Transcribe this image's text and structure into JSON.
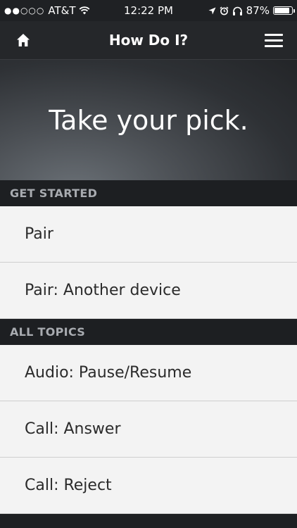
{
  "status_bar": {
    "carrier": "AT&T",
    "time": "12:22 PM",
    "battery": "87%",
    "battery_level": 0.87,
    "icons": [
      "signal-dots-icon",
      "wifi-icon",
      "location-icon",
      "alarm-icon",
      "headphones-icon",
      "battery-icon"
    ]
  },
  "nav": {
    "title": "How Do I?",
    "home_icon": "home-icon",
    "menu_icon": "hamburger-menu-icon"
  },
  "hero": {
    "title": "Take your pick."
  },
  "sections": [
    {
      "header": "Get Started",
      "items": [
        "Pair",
        "Pair: Another device"
      ]
    },
    {
      "header": "All Topics",
      "items": [
        "Audio: Pause/Resume",
        "Call: Answer",
        "Call: Reject"
      ]
    }
  ],
  "colors": {
    "background": "#1e2023",
    "list_bg": "#f3f3f3",
    "section_header_text": "#a8abb0"
  }
}
